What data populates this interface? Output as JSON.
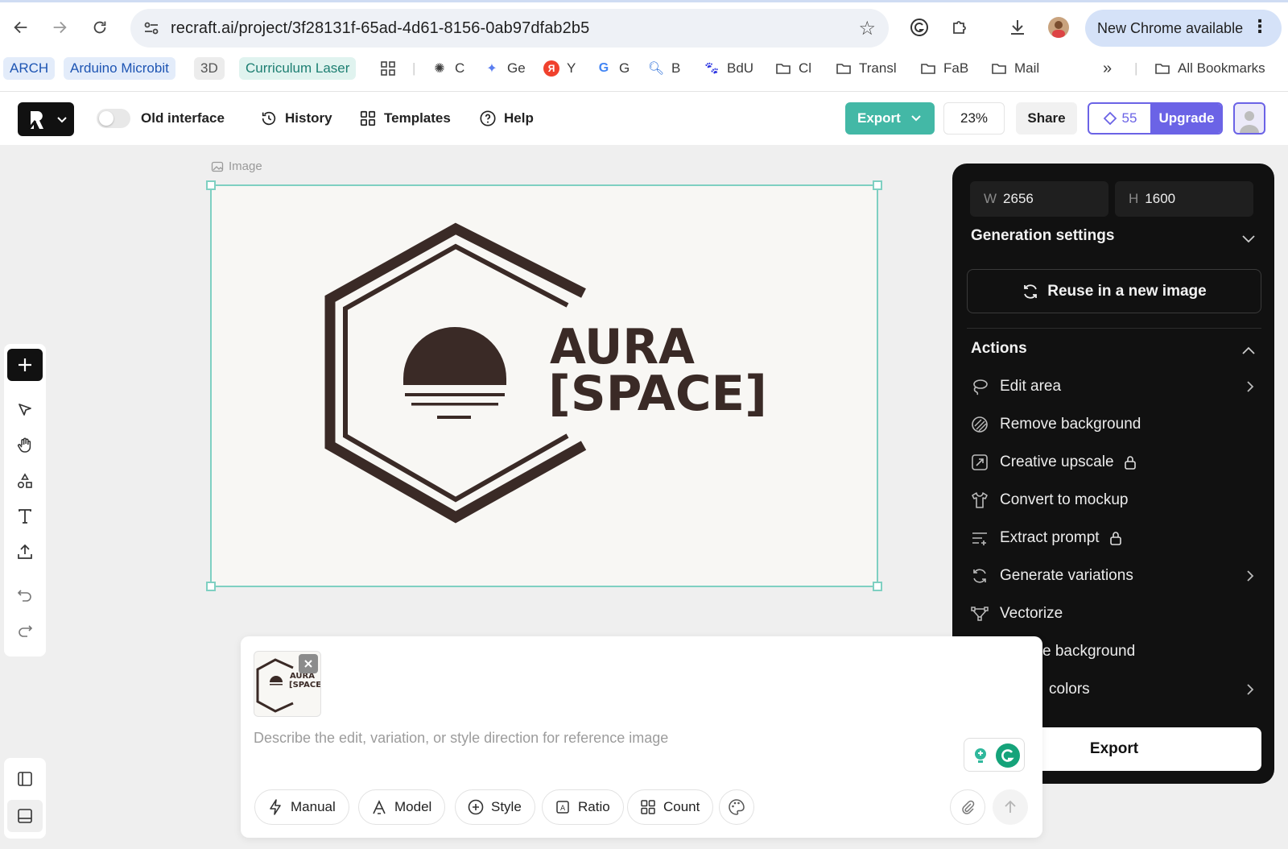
{
  "browser": {
    "url": "recraft.ai/project/3f28131f-65ad-4d61-8156-0ab97dfab2b5",
    "new_chrome_label": "New Chrome available",
    "bookmarks": [
      {
        "label": "ARCH",
        "icon": "pill"
      },
      {
        "label": "Arduino Microbit",
        "icon": "pill"
      },
      {
        "label": "3D",
        "icon": "pill"
      },
      {
        "label": "Curriculum Laser",
        "icon": "pill"
      },
      {
        "label": "C",
        "icon": "openai-icon"
      },
      {
        "label": "Ge",
        "icon": "gemini-icon"
      },
      {
        "label": "Y",
        "icon": "yandex-icon"
      },
      {
        "label": "G",
        "icon": "google-icon"
      },
      {
        "label": "B",
        "icon": "search-icon"
      },
      {
        "label": "BdU",
        "icon": "baidu-icon"
      },
      {
        "label": "Cl",
        "icon": "folder-icon"
      },
      {
        "label": "Transl",
        "icon": "folder-icon"
      },
      {
        "label": "FaB",
        "icon": "folder-icon"
      },
      {
        "label": "Mail",
        "icon": "folder-icon"
      }
    ],
    "more_label": "»",
    "all_bookmarks_label": "All Bookmarks"
  },
  "toolbar": {
    "old_interface_label": "Old interface",
    "history_label": "History",
    "templates_label": "Templates",
    "help_label": "Help",
    "export_label": "Export",
    "zoom": "23%",
    "share_label": "Share",
    "credits": "55",
    "upgrade_label": "Upgrade"
  },
  "canvas": {
    "label": "Image",
    "logo_line1": "AURA",
    "logo_line2": "[SPACE]"
  },
  "panel": {
    "width_label": "W",
    "width_value": "2656",
    "height_label": "H",
    "height_value": "1600",
    "generation_settings_title": "Generation settings",
    "reuse_label": "Reuse in a new image",
    "actions_title": "Actions",
    "actions": [
      {
        "label": "Edit area",
        "icon": "lasso-icon",
        "arrow": true,
        "locked": false
      },
      {
        "label": "Remove background",
        "icon": "remove-bg-icon",
        "arrow": false,
        "locked": false
      },
      {
        "label": "Creative upscale",
        "icon": "upscale-icon",
        "arrow": false,
        "locked": true
      },
      {
        "label": "Convert to mockup",
        "icon": "shirt-icon",
        "arrow": false,
        "locked": false
      },
      {
        "label": "Extract prompt",
        "icon": "text-lines-icon",
        "arrow": false,
        "locked": true
      },
      {
        "label": "Generate variations",
        "icon": "refresh-icon",
        "arrow": true,
        "locked": false
      },
      {
        "label": "Vectorize",
        "icon": "vector-icon",
        "arrow": false,
        "locked": false
      },
      {
        "label": "e background",
        "icon": "",
        "arrow": false,
        "locked": false
      },
      {
        "label": "colors",
        "icon": "",
        "arrow": true,
        "locked": false
      }
    ],
    "export_label": "Export"
  },
  "prompt": {
    "placeholder": "Describe the edit, variation, or style direction for reference image",
    "thumb_line1": "AURA",
    "thumb_line2": "[SPACE",
    "chips": [
      {
        "label": "Manual",
        "icon": "bolt-icon"
      },
      {
        "label": "Model",
        "icon": "model-icon"
      },
      {
        "label": "Style",
        "icon": "plus-circle-icon"
      },
      {
        "label": "Ratio",
        "icon": "ratio-icon"
      },
      {
        "label": "Count",
        "icon": "grid-icon"
      }
    ]
  },
  "colors": {
    "accent_teal": "#43b8a6",
    "upgrade_purple": "#6b63e6",
    "panel_bg": "#111111",
    "logo_brown": "#3a2a26"
  }
}
